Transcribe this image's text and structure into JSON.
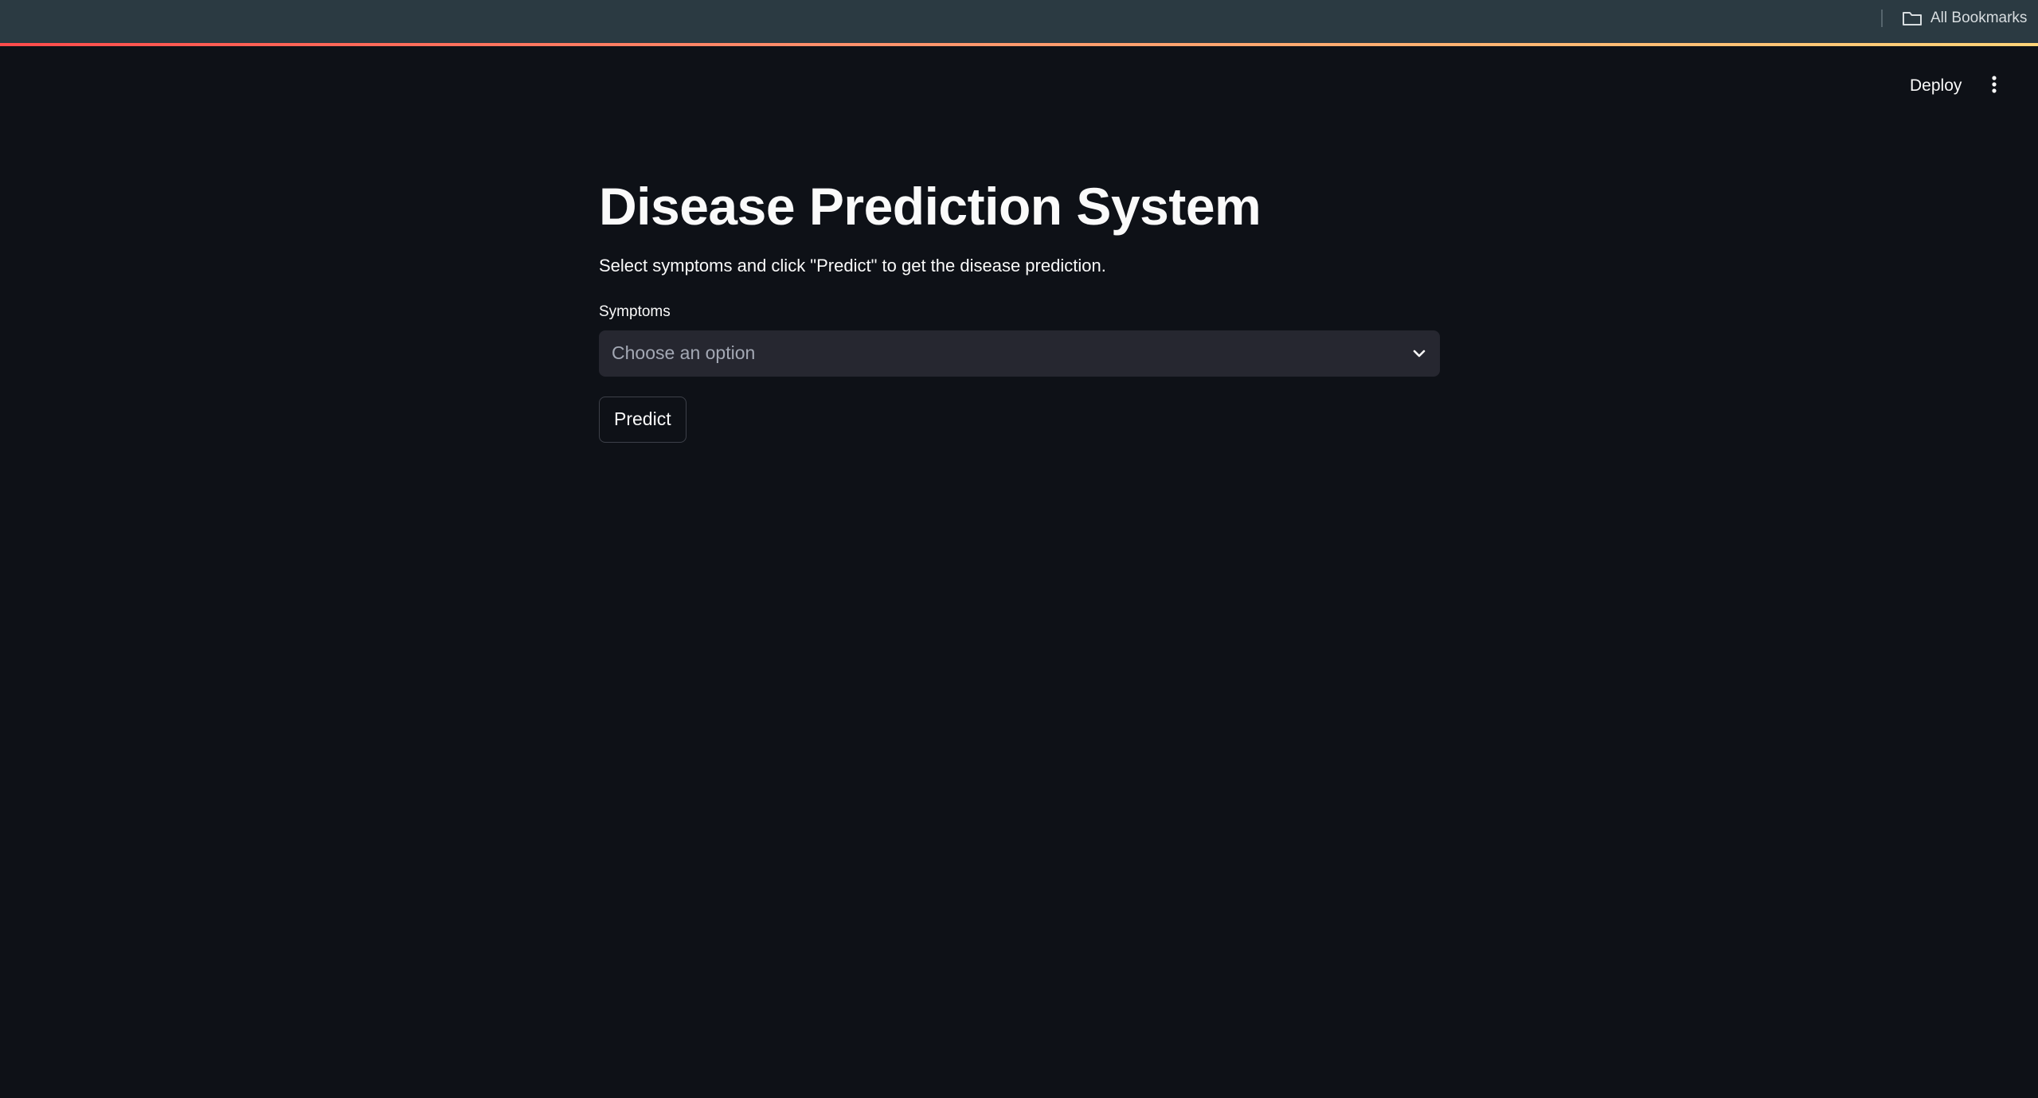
{
  "browser": {
    "bookmarks_label": "All Bookmarks"
  },
  "toolbar": {
    "deploy_label": "Deploy"
  },
  "main": {
    "title": "Disease Prediction System",
    "description": "Select symptoms and click \"Predict\" to get the disease prediction.",
    "symptoms_field": {
      "label": "Symptoms",
      "placeholder": "Choose an option"
    },
    "predict_label": "Predict"
  },
  "colors": {
    "background": "#0e1117",
    "bookmarks_bar": "#2b3a42",
    "select_background": "#262730",
    "accent_gradient_start": "#ff4b4b",
    "accent_gradient_end": "#ffd479"
  },
  "icons": {
    "bookmarks": "folder-icon",
    "menu": "vertical-dots-icon",
    "select": "chevron-down-icon"
  }
}
